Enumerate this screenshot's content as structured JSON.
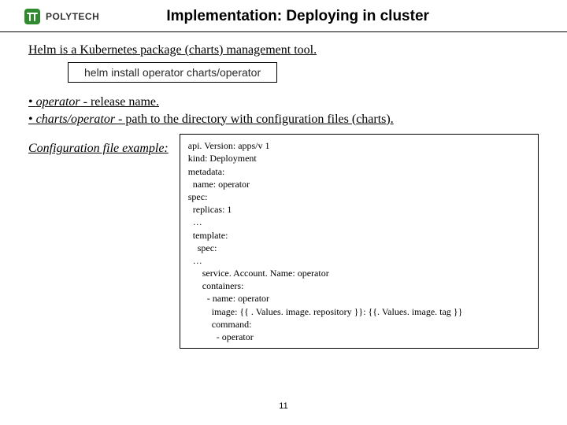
{
  "header": {
    "logo_text": "POLYTECH",
    "title": "Implementation: Deploying in cluster"
  },
  "intro": "Helm is a Kubernetes package (charts) management tool.",
  "command": "helm install operator charts/operator",
  "bullets": {
    "b1_prefix": "• ",
    "b1_em": "operator",
    "b1_rest": " - release name.",
    "b2_prefix": "• ",
    "b2_em": "charts/operator",
    "b2_rest": " - path to the directory with configuration files (charts)."
  },
  "config_label": "Configuration file example:",
  "code": "api. Version: apps/v 1\nkind: Deployment\nmetadata:\n  name: operator\nspec:\n  replicas: 1\n  …\n  template:\n    spec:\n  …\n      service. Account. Name: operator\n      containers:\n        - name: operator\n          image: {{ . Values. image. repository }}: {{. Values. image. tag }}\n          command:\n            - operator",
  "page_number": "11"
}
